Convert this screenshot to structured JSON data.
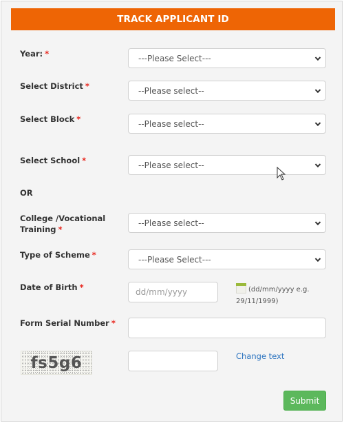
{
  "header": {
    "title": "TRACK APPLICANT ID"
  },
  "required_marker": "*",
  "fields": {
    "year": {
      "label": "Year:",
      "value": "---Please Select---"
    },
    "district": {
      "label": "Select District",
      "value": "--Please select--"
    },
    "block": {
      "label": "Select Block",
      "value": "--Please select--"
    },
    "school": {
      "label": "Select School",
      "value": "--Please select--"
    },
    "or_text": "OR",
    "college": {
      "label_line1": "College /Vocational",
      "label_line2": "Training",
      "value": "--Please select--"
    },
    "scheme": {
      "label": "Type of Scheme",
      "value": "---Please Select---"
    },
    "dob": {
      "label": "Date of Birth",
      "placeholder": "dd/mm/yyyy",
      "value": "",
      "hint": "(dd/mm/yyyy e.g. 29/11/1999)"
    },
    "serial": {
      "label": "Form Serial Number",
      "value": ""
    },
    "captcha": {
      "image_text": "fs5g6",
      "value": "",
      "change_link": "Change text"
    }
  },
  "actions": {
    "submit_label": "Submit"
  },
  "colors": {
    "header": "#ee6505",
    "submit": "#5cb85c",
    "link": "#2e75c0",
    "required": "#e8261d"
  }
}
